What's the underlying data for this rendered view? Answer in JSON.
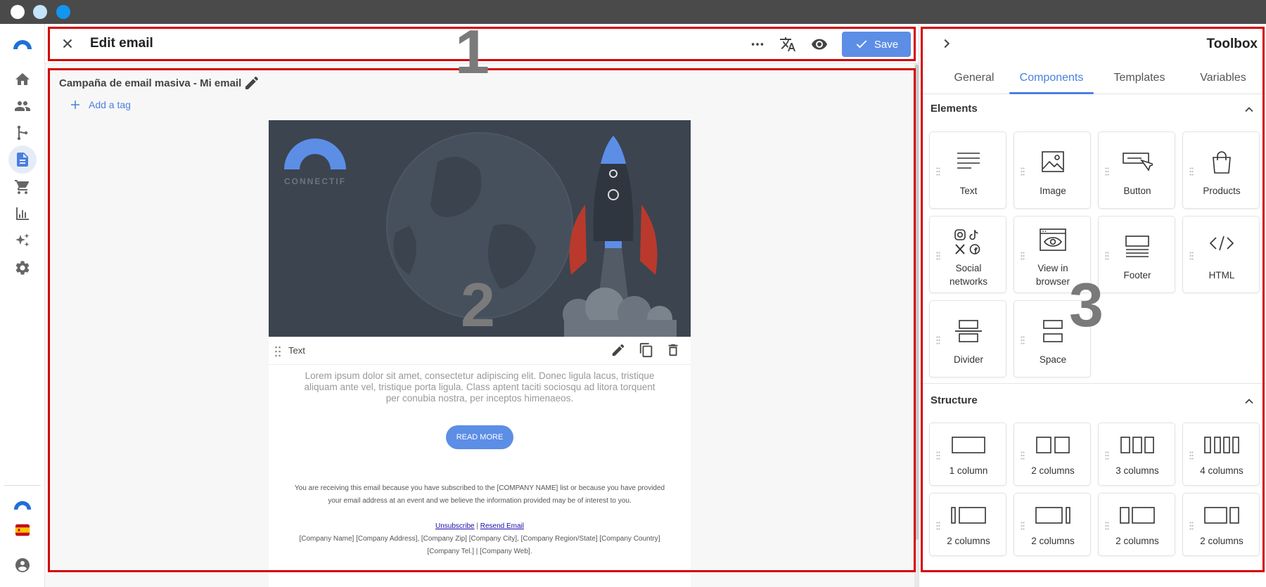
{
  "header": {
    "title": "Edit email",
    "save_label": "Save"
  },
  "main": {
    "campaign_title": "Campaña de email masiva - Mi email",
    "add_tag_label": "Add a tag",
    "email": {
      "logo_text": "CONNECTIF",
      "block_label": "Text",
      "lorem": "Lorem ipsum dolor sit amet, consectetur adipiscing elit. Donec ligula lacus, tristique aliquam ante vel, tristique porta ligula. Class aptent taciti sociosqu ad litora torquent per conubia nostra, per inceptos himenaeos.",
      "read_more": "READ MORE",
      "footer_notice": "You are receiving this email because you have subscribed to the [COMPANY NAME] list or because you have provided your email address at an event and we believe the information provided may be of interest to you.",
      "unsubscribe": "Unsubscribe",
      "separator": "|",
      "resend": "Resend Email",
      "company_line1": "[Company Name] [Company Address], [Company Zip] [Company City], [Company Region/State] [Company Country]",
      "company_line2": "[Company Tel.] | [Company Web]."
    }
  },
  "toolbox": {
    "title": "Toolbox",
    "tabs": [
      "General",
      "Components",
      "Templates",
      "Variables"
    ],
    "active_tab": "Components",
    "elements_heading": "Elements",
    "structure_heading": "Structure",
    "elements": [
      {
        "label": "Text",
        "icon": "text-lines-icon"
      },
      {
        "label": "Image",
        "icon": "image-icon"
      },
      {
        "label": "Button",
        "icon": "button-cursor-icon"
      },
      {
        "label": "Products",
        "icon": "shopping-bag-icon"
      },
      {
        "label": "Social networks",
        "icon": "social-icons"
      },
      {
        "label": "View in browser",
        "icon": "browser-eye-icon"
      },
      {
        "label": "Footer",
        "icon": "footer-icon"
      },
      {
        "label": "HTML",
        "icon": "code-icon"
      },
      {
        "label": "Divider",
        "icon": "divider-icon"
      },
      {
        "label": "Space",
        "icon": "space-icon"
      }
    ],
    "structures": [
      {
        "label": "1 column",
        "icon": "one-column-icon"
      },
      {
        "label": "2 columns",
        "icon": "two-columns-icon"
      },
      {
        "label": "3 columns",
        "icon": "three-columns-icon"
      },
      {
        "label": "4 columns",
        "icon": "four-columns-icon"
      },
      {
        "label": "2 columns",
        "icon": "narrow-left-columns-icon"
      },
      {
        "label": "2 columns",
        "icon": "narrow-right-columns-icon"
      },
      {
        "label": "2 columns",
        "icon": "wide-right-columns-icon"
      },
      {
        "label": "2 columns",
        "icon": "wide-left-columns-icon"
      }
    ]
  },
  "annotations": [
    "1",
    "2",
    "3"
  ],
  "colors": {
    "accent": "#5c8ee6",
    "active_tab": "#4a7fe0",
    "annotation_box": "#d40000",
    "hero_bg": "#3c4450"
  }
}
